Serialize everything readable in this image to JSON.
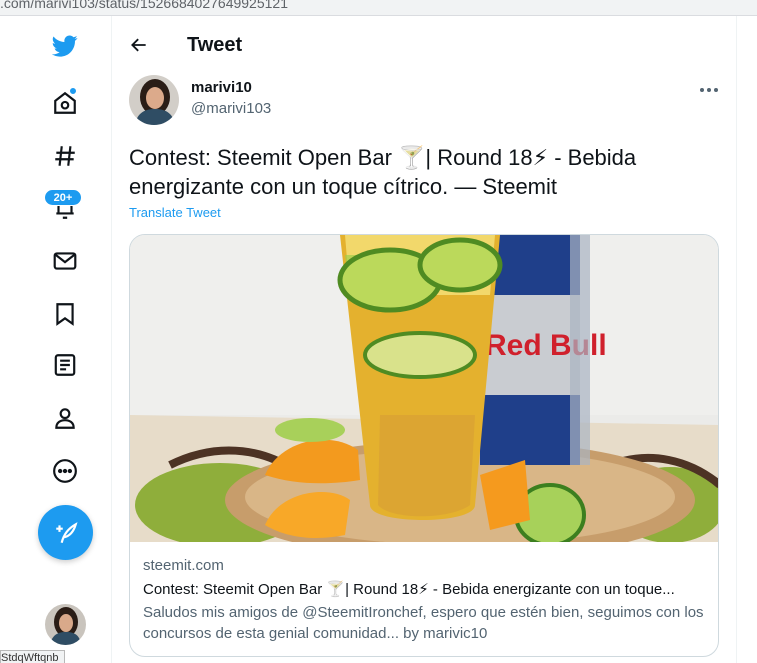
{
  "browser": {
    "url_fragment": ".com/marivi103/status/1526684027649925121",
    "status_tooltip": "StdqWftqnb"
  },
  "sidebar": {
    "items": [
      {
        "name": "twitter-logo",
        "icon": "twitter-bird-icon"
      },
      {
        "name": "home",
        "icon": "home-icon"
      },
      {
        "name": "explore",
        "icon": "hashtag-icon"
      },
      {
        "name": "notifications",
        "icon": "bell-icon"
      },
      {
        "name": "messages",
        "icon": "mail-icon"
      },
      {
        "name": "bookmarks",
        "icon": "bookmark-icon"
      },
      {
        "name": "lists",
        "icon": "lists-icon"
      },
      {
        "name": "profile",
        "icon": "person-icon"
      },
      {
        "name": "more",
        "icon": "more-circle-icon"
      }
    ],
    "notifications_badge": "20+"
  },
  "header": {
    "title": "Tweet"
  },
  "tweet": {
    "display_name": "marivi10",
    "handle": "@marivi103",
    "text": "Contest: Steemit Open Bar 🍸| Round 18⚡ - Bebida energizante con un toque cítrico. — Steemit",
    "translate_label": "Translate Tweet"
  },
  "card": {
    "domain": "steemit.com",
    "title": "Contest: Steemit Open Bar 🍸| Round 18⚡ - Bebida energizante con un toque...",
    "description": "Saludos mis amigos de @SteemitIronchef, espero que estén bien, seguimos con los concursos de esta genial comunidad... by marivic10",
    "image_label": "Red Bull"
  },
  "colors": {
    "accent": "#1d9bf0",
    "text": "#0f1419",
    "secondary": "#536471",
    "border": "#cfd9de"
  }
}
